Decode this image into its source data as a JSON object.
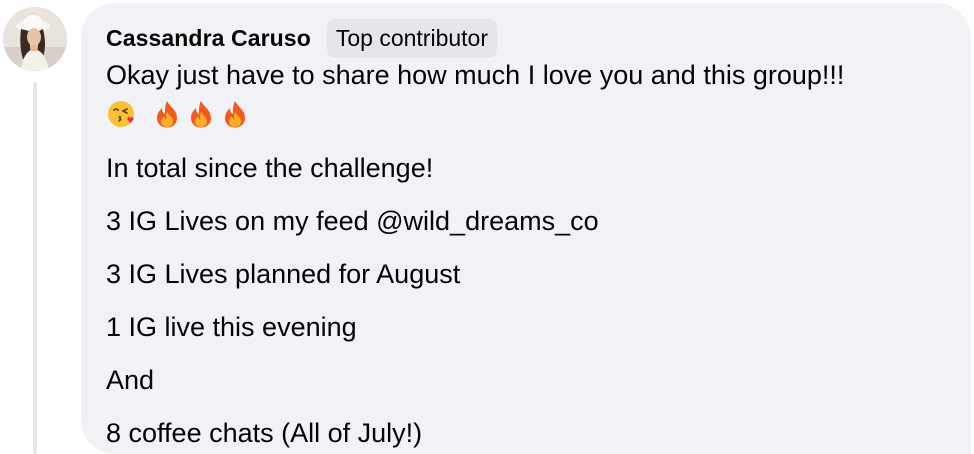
{
  "comment": {
    "author": "Cassandra Caruso",
    "badge": "Top contributor",
    "avatar_icon": "user-avatar-photo",
    "lines": [
      "Okay just have to share how much I love you and this group!!!",
      "In total since the challenge!",
      "3 IG Lives on my feed @wild_dreams_co",
      "3 IG Lives planned for August",
      "1 IG live this evening",
      "And",
      "8 coffee chats (All of July!)"
    ],
    "emojis": [
      "face-blowing-kiss-icon",
      "fire-icon",
      "fire-icon",
      "fire-icon"
    ]
  },
  "colors": {
    "bubble_background": "#f0f2f5",
    "badge_background": "#e4e6eb",
    "text": "#050505",
    "thread_line": "#e4e6ea"
  }
}
